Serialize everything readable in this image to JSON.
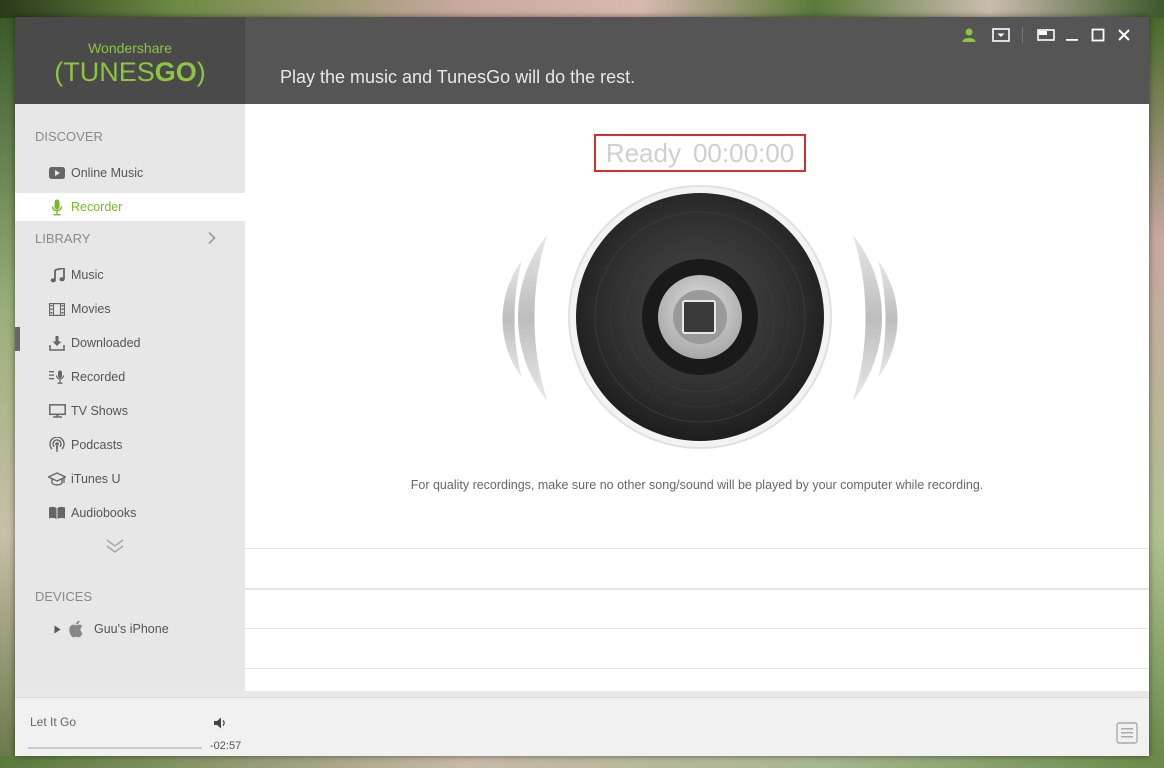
{
  "app": {
    "brand_top": "Wondershare",
    "brand_light": "TUNES",
    "brand_bold": "GO",
    "tagline": "Play the music and TunesGo will do the rest."
  },
  "colors": {
    "accent": "#8cc63f",
    "header": "#555555",
    "sidebar": "#e7e7e7",
    "highlight": "#d32f2f"
  },
  "window_controls": [
    "user-icon",
    "dropdown-icon",
    "mini-mode-icon",
    "minimize-icon",
    "maximize-icon",
    "close-icon"
  ],
  "sidebar": {
    "discover_title": "DISCOVER",
    "discover_items": [
      {
        "label": "Online Music",
        "icon": "youtube-icon"
      },
      {
        "label": "Recorder",
        "icon": "microphone-icon",
        "active": true
      }
    ],
    "library_title": "LIBRARY",
    "library_items": [
      {
        "label": "Music",
        "icon": "music-note-icon"
      },
      {
        "label": "Movies",
        "icon": "film-icon"
      },
      {
        "label": "Downloaded",
        "icon": "download-icon"
      },
      {
        "label": "Recorded",
        "icon": "recorded-icon"
      },
      {
        "label": "TV Shows",
        "icon": "tv-icon"
      },
      {
        "label": "Podcasts",
        "icon": "podcast-icon"
      },
      {
        "label": "iTunes U",
        "icon": "graduation-cap-icon"
      },
      {
        "label": "Audiobooks",
        "icon": "book-icon"
      }
    ],
    "devices_title": "DEVICES",
    "device": {
      "label": "Guu's iPhone",
      "icon": "apple-icon"
    }
  },
  "recorder": {
    "status": "Ready",
    "timer": "00:00:00",
    "hint": "For quality recordings, make sure no other song/sound will be played by your computer while recording."
  },
  "player": {
    "track": "Let It Go",
    "remaining": "-02:57",
    "progress": 0
  }
}
